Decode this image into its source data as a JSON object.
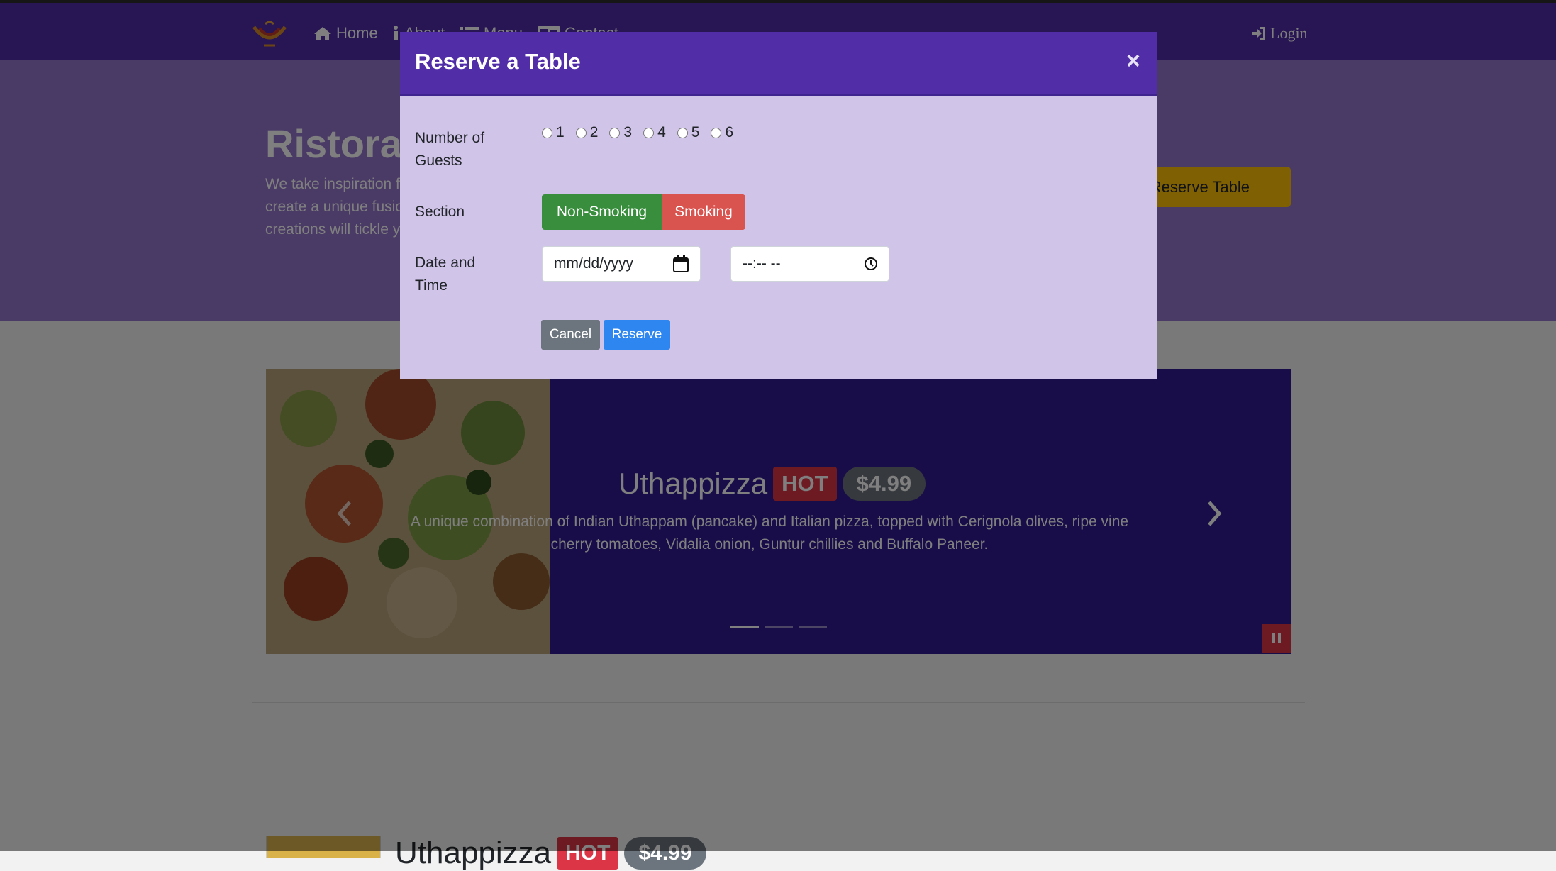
{
  "colors": {
    "primary": "#512da8",
    "primary_light": "#9575cd",
    "primary_dark": "#311b92",
    "modal_body": "#d1c4e9",
    "warning": "#ffc107",
    "success": "#388e3c",
    "danger": "#dc3545",
    "secondary": "#6c757d",
    "info": "#2e86f0"
  },
  "navbar": {
    "logo_icon": "restaurant-logo-icon",
    "items": [
      {
        "label": "Home",
        "icon": "home-icon"
      },
      {
        "label": "About",
        "icon": "info-icon"
      },
      {
        "label": "Menu",
        "icon": "list-icon"
      },
      {
        "label": "Contact",
        "icon": "address-card-icon"
      }
    ],
    "login": {
      "label": "Login",
      "icon": "sign-in-icon"
    }
  },
  "hero": {
    "title": "Ristorante con Fusion",
    "text": "We take inspiration from the World's best cuisines, and create a unique fusion experience. Our lipsmacking creations will tickle your culinary senses!",
    "button_label": "Reserve Table"
  },
  "carousel": {
    "title": "Uthappizza",
    "badge": "HOT",
    "price": "$4.99",
    "description": "A unique combination of Indian Uthappam (pancake) and Italian pizza, topped with Cerignola olives, ripe vine cherry tomatoes, Vidalia onion, Guntur chillies and Buffalo Paneer.",
    "indicators": 3,
    "active_indicator": 1
  },
  "media": {
    "title": "Uthappizza",
    "badge": "HOT",
    "price": "$4.99"
  },
  "modal": {
    "title": "Reserve a Table",
    "close": "×",
    "guests_label": "Number of Guests",
    "guest_options": [
      "1",
      "2",
      "3",
      "4",
      "5",
      "6"
    ],
    "section_label": "Section",
    "section_options": {
      "non_smoking": "Non-Smoking",
      "smoking": "Smoking"
    },
    "datetime_label": "Date and Time",
    "date_placeholder": "mm/dd/yyyy",
    "time_placeholder": "--:-- --",
    "cancel_label": "Cancel",
    "reserve_label": "Reserve"
  }
}
